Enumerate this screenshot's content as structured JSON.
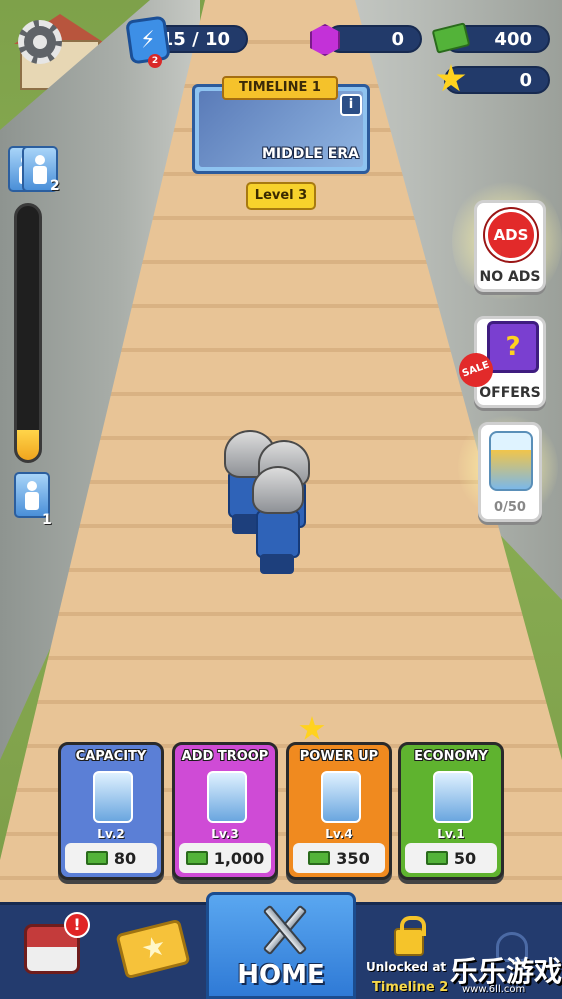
{
  "stats": {
    "energy": "15 / 10",
    "energy_badge": "2",
    "gems": "0",
    "cash": "400",
    "stars": "0"
  },
  "timeline": {
    "title": "TIMELINE 1",
    "era": "MIDDLE ERA",
    "info_label": "i",
    "level": "Level 3"
  },
  "progress": {
    "top_count": "2",
    "bottom_count": "1",
    "fill_fraction": 0.12
  },
  "side_buttons": {
    "ads_badge": "ADS",
    "no_ads_label": "NO ADS",
    "sale_badge": "SALE",
    "offers_label": "OFFERS",
    "jar_label": "0/50"
  },
  "upgrades": [
    {
      "title": "CAPACITY",
      "level": "Lv.2",
      "cost": "80",
      "color": "#5b7fd6"
    },
    {
      "title": "ADD TROOP",
      "level": "Lv.3",
      "cost": "1,000",
      "color": "#cf4bd6"
    },
    {
      "title": "POWER UP",
      "level": "Lv.4",
      "cost": "350",
      "color": "#f08a1f"
    },
    {
      "title": "ECONOMY",
      "level": "Lv.1",
      "cost": "50",
      "color": "#5fb32f"
    }
  ],
  "nav": {
    "home_label": "HOME",
    "alert_badge": "!",
    "unlock_text": "Unlocked at",
    "unlock_timeline": "Timeline 2"
  },
  "watermark": {
    "text": "乐乐游戏",
    "url": "www.6ll.com"
  },
  "icons": [
    "gear-icon",
    "lightning-icon",
    "gem-icon",
    "cash-icon",
    "star-icon",
    "info-icon",
    "troop-icon",
    "ads-icon",
    "mystery-box-icon",
    "jar-icon",
    "chest-icon",
    "ticket-icon",
    "swords-icon",
    "lock-icon"
  ],
  "colors": {
    "topbar": "#223a6a",
    "navbar": "#233b6e",
    "home_tab": "#2f7ad6",
    "road": "#e8c496",
    "level_tag": "#f7d22c"
  }
}
